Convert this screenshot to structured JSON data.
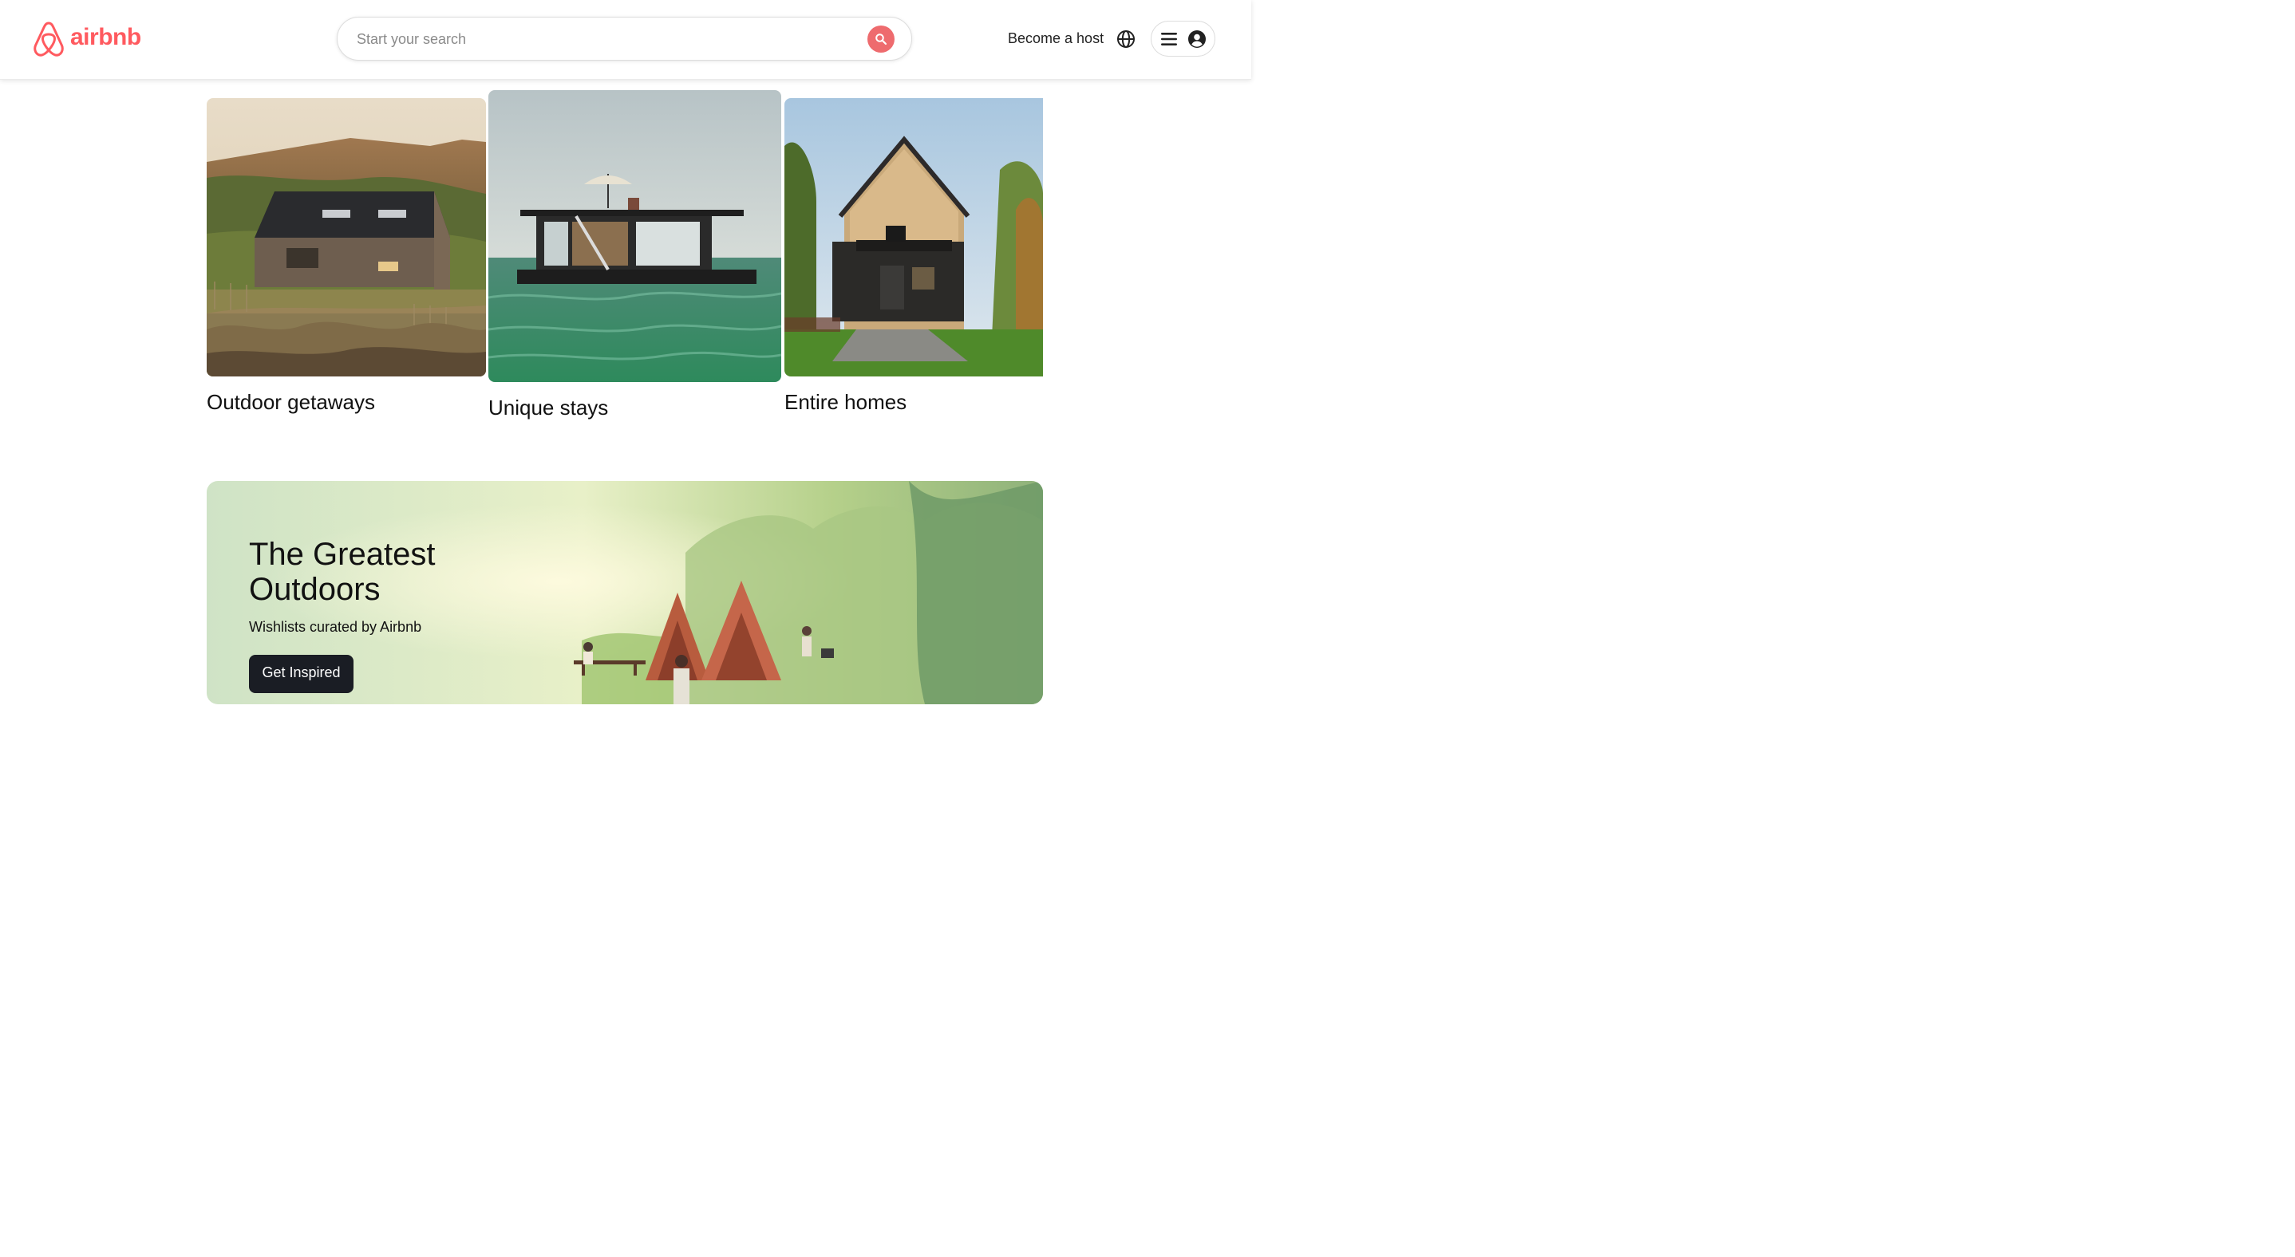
{
  "brand": {
    "name": "airbnb",
    "color": "#FF5A5F"
  },
  "header": {
    "search": {
      "placeholder": "Start your search",
      "value": ""
    },
    "host_link": "Become a host",
    "icons": {
      "search": "search-icon",
      "globe": "globe-icon",
      "menu": "hamburger-menu-icon",
      "user": "user-avatar-icon"
    }
  },
  "categories": [
    {
      "label": "Outdoor getaways",
      "image": "wooden-cottage-photo"
    },
    {
      "label": "Unique stays",
      "image": "houseboat-photo"
    },
    {
      "label": "Entire homes",
      "image": "a-frame-house-photo"
    }
  ],
  "banner": {
    "title": "The Greatest Outdoors",
    "subtitle": "Wishlists curated by Airbnb",
    "button": "Get Inspired",
    "image": "illustrated-campsite"
  },
  "colors": {
    "search_button": "#EE6B6E",
    "cta_button": "#1a1d24"
  }
}
